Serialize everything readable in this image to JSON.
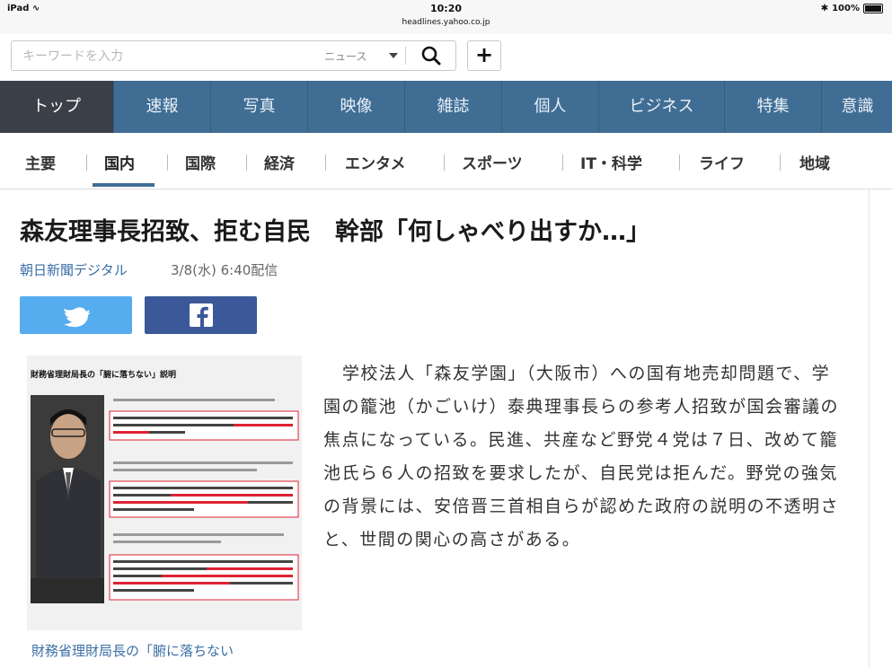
{
  "status_bar": {
    "device": "iPad",
    "time": "10:20",
    "url": "headlines.yahoo.co.jp",
    "battery": "100%"
  },
  "search": {
    "placeholder": "キーワードを入力",
    "scope": "ニュース",
    "add_label": "+"
  },
  "nav": {
    "items": [
      "トップ",
      "速報",
      "写真",
      "映像",
      "雑誌",
      "個人",
      "ビジネス",
      "特集",
      "意識"
    ],
    "active_index": 0
  },
  "subnav": {
    "items": [
      "主要",
      "国内",
      "国際",
      "経済",
      "エンタメ",
      "スポーツ",
      "IT・科学",
      "ライフ",
      "地域"
    ],
    "active_index": 1
  },
  "article": {
    "headline": "森友理事長招致、拒む自民　幹部「何しゃべり出すか…」",
    "source": "朝日新聞デジタル",
    "date": "3/8(水) 6:40配信",
    "share": {
      "twitter_icon": "twitter-bird-icon",
      "facebook_icon": "facebook-f-icon"
    },
    "photo_title": "財務省理財局長の「腑に落ちない」説明",
    "caption": "財務省理財局長の「腑に落ちない",
    "body": "学校法人「森友学園」（大阪市）への国有地売却問題で、学園の籠池（かごいけ）泰典理事長らの参考人招致が国会審議の焦点になっている。民進、共産など野党４党は７日、改めて籠池氏ら６人の招致を要求したが、自民党は拒んだ。野党の強気の背景には、安倍晋三首相自らが認めた政府の説明の不透明さと、世間の関心の高さがある。"
  },
  "colors": {
    "nav_bg": "#3f6d94",
    "nav_active_bg": "#3b3f48",
    "link": "#3a6ea5",
    "twitter": "#55acee",
    "facebook": "#3b5998"
  }
}
